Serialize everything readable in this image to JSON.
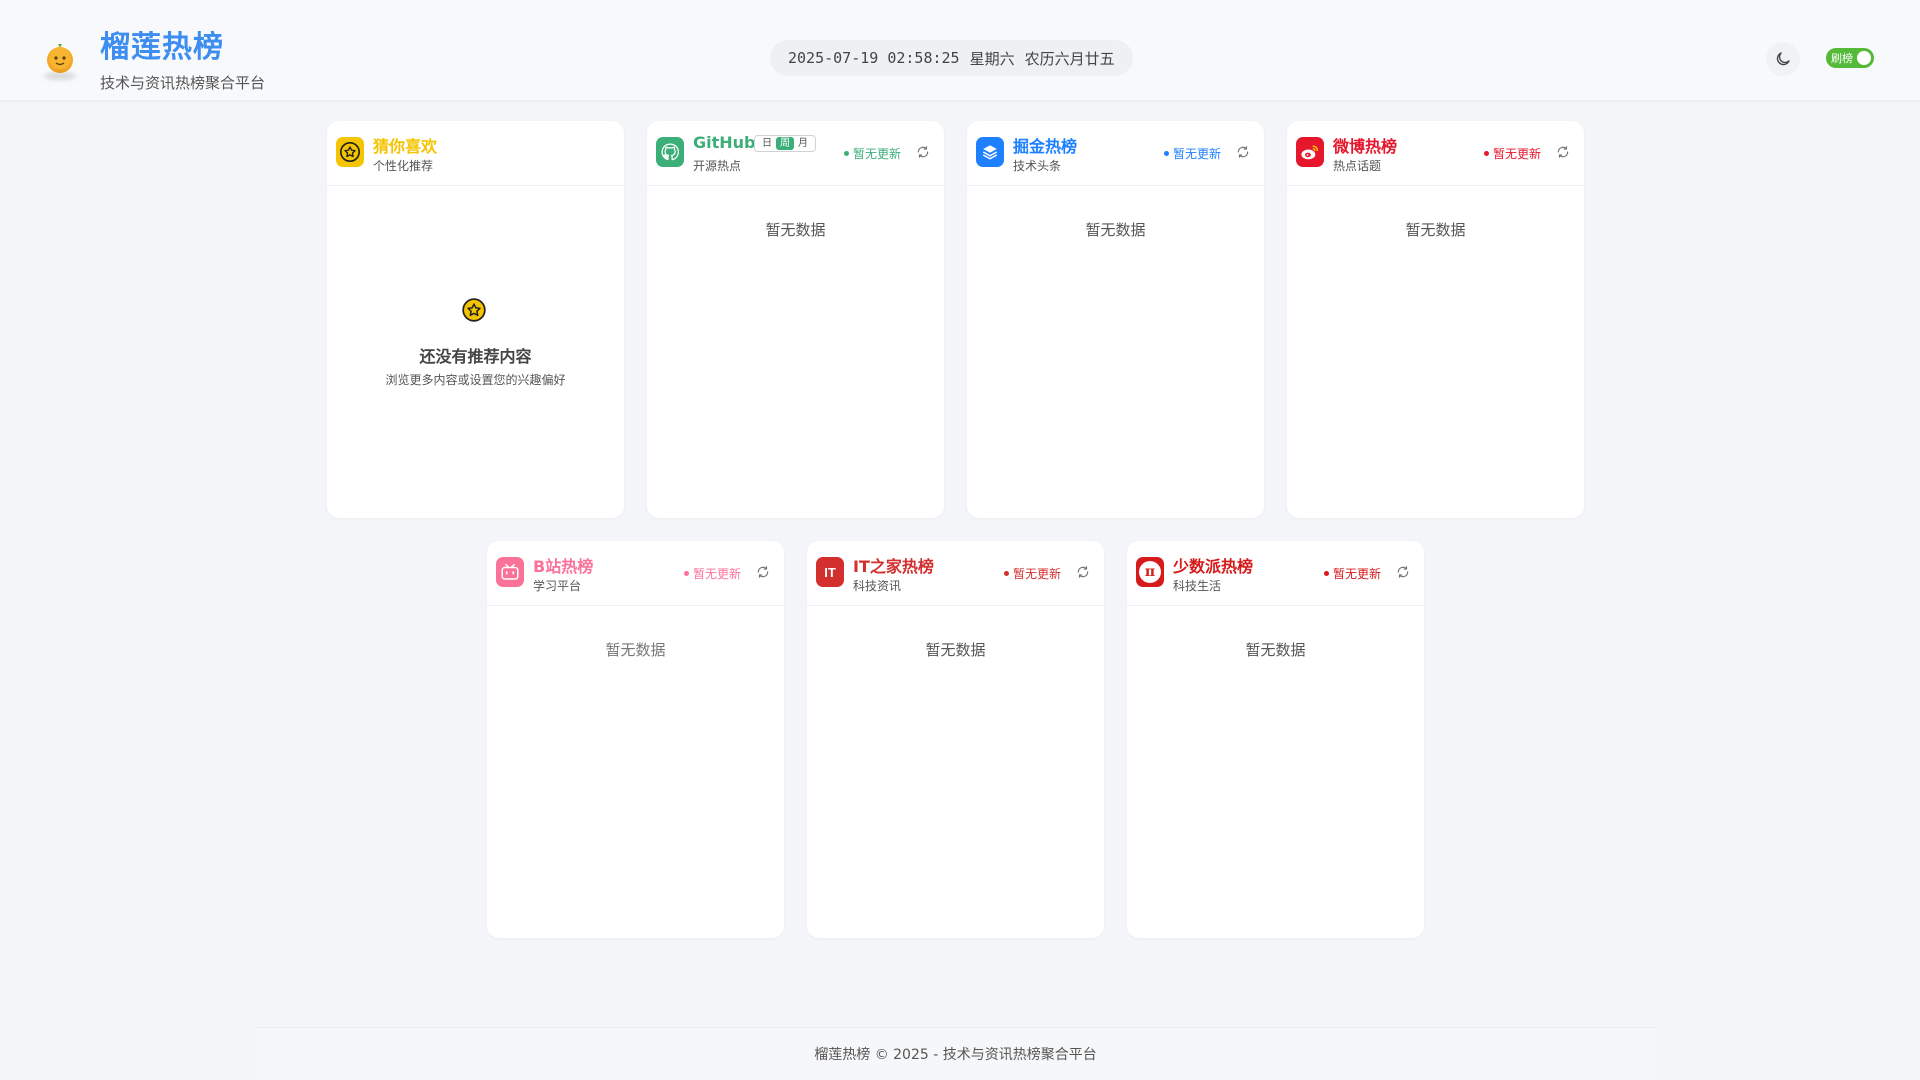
{
  "header": {
    "title": "榴莲热榜",
    "subtitle": "技术与资讯热榜聚合平台",
    "datetime": {
      "date": "2025-07-19 02:58:25",
      "weekday": "星期六",
      "lunar": "农历六月廿五"
    },
    "toggle_label": "刷榜",
    "toggle_on": true
  },
  "colors": {
    "brand": "#3d8ef0",
    "toggle": "#55b93a",
    "github": "#3cae78",
    "juejin": "#1e80ff",
    "weibo": "#e6162d",
    "bilibili": "#fb7299",
    "ithome": "#d32f2f",
    "sspai": "#d71a1b",
    "guess": "#f5c400"
  },
  "cards": {
    "guess": {
      "title": "猜你喜欢",
      "subtitle": "个性化推荐",
      "icon": "star-badge-icon",
      "empty_title": "还没有推荐内容",
      "empty_sub": "浏览更多内容或设置您的兴趣偏好"
    },
    "github": {
      "title": "GitHub",
      "subtitle": "开源热点",
      "icon": "github-icon",
      "tabs": [
        "日",
        "周",
        "月"
      ],
      "active_tab": "周",
      "status": "暂无更新",
      "empty": "暂无数据"
    },
    "juejin": {
      "title": "掘金热榜",
      "subtitle": "技术头条",
      "icon": "juejin-layers-icon",
      "status": "暂无更新",
      "empty": "暂无数据"
    },
    "weibo": {
      "title": "微博热榜",
      "subtitle": "热点话题",
      "icon": "weibo-icon",
      "status": "暂无更新",
      "empty": "暂无数据"
    },
    "bilibili": {
      "title": "B站热榜",
      "subtitle": "学习平台",
      "icon": "bilibili-tv-icon",
      "status": "暂无更新",
      "empty": "暂无数据"
    },
    "ithome": {
      "title": "IT之家热榜",
      "subtitle": "科技资讯",
      "icon": "ithome-it-icon",
      "icon_text": "IT",
      "status": "暂无更新",
      "empty": "暂无数据"
    },
    "sspai": {
      "title": "少数派热榜",
      "subtitle": "科技生活",
      "icon": "sspai-pi-icon",
      "icon_text": "π",
      "status": "暂无更新",
      "empty": "暂无数据"
    }
  },
  "footer": {
    "text": "榴莲热榜 © 2025 - 技术与资讯热榜聚合平台"
  }
}
